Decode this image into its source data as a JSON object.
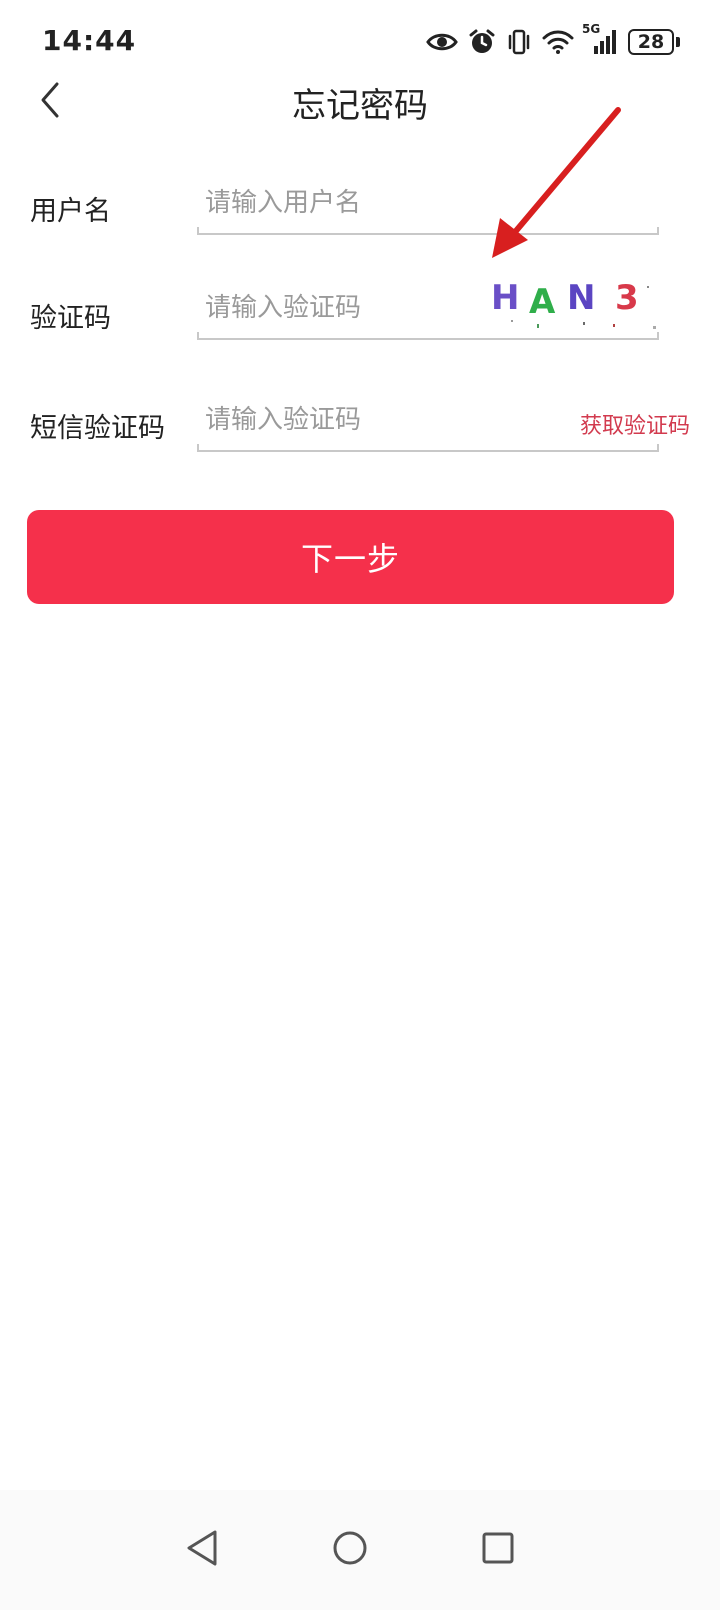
{
  "status_bar": {
    "time": "14:44",
    "network": "5G",
    "battery": "28",
    "icons": [
      "eye-icon",
      "alarm-icon",
      "vibrate-icon",
      "wifi-icon",
      "signal-icon",
      "battery-icon"
    ]
  },
  "header": {
    "title": "忘记密码",
    "back_icon": "chevron-left-icon"
  },
  "form": {
    "username": {
      "label": "用户名",
      "placeholder": "请输入用户名",
      "value": ""
    },
    "captcha": {
      "label": "验证码",
      "placeholder": "请输入验证码",
      "value": "",
      "image_chars": [
        "H",
        "A",
        "N",
        "3"
      ],
      "image_colors": [
        "#6a4fc7",
        "#2fae4a",
        "#5b45c2",
        "#d8394a"
      ]
    },
    "sms_code": {
      "label": "短信验证码",
      "placeholder": "请输入验证码",
      "value": "",
      "get_code_label": "获取验证码"
    }
  },
  "next_button": {
    "label": "下一步"
  },
  "colors": {
    "primary": "#f5304b",
    "link": "#d23a4e",
    "annotation_arrow": "#d81f1f"
  },
  "nav": {
    "icons": [
      "back-triangle-icon",
      "home-circle-icon",
      "recents-square-icon"
    ]
  }
}
